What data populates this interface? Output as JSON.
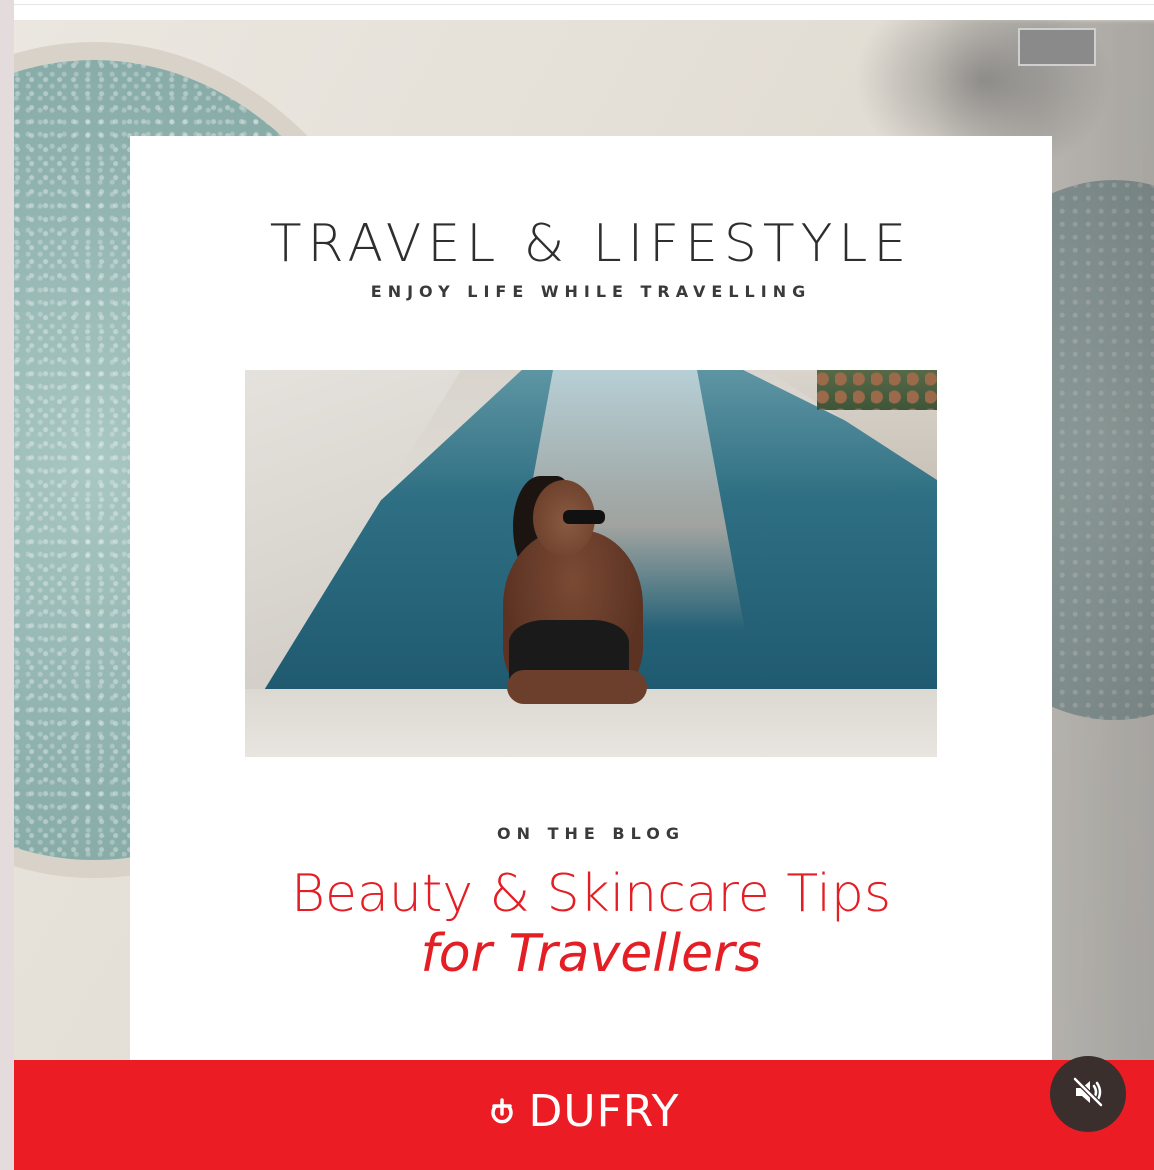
{
  "post": {
    "title": "TRAVEL & LIFESTYLE",
    "subtitle": "ENJOY LIFE WHILE TRAVELLING",
    "kicker": "ON THE BLOG",
    "headline_line1": "Beauty & Skincare Tips",
    "headline_line2": "for Travellers",
    "photo_alt": "Woman in sunglasses leaning on the edge of a pool"
  },
  "brand": {
    "name": "DUFRY",
    "logo_icon": "dufry-logo-icon",
    "bar_color": "#ec1c24"
  },
  "controls": {
    "mute_icon": "muted-speaker-icon",
    "mute_label": "Unmute"
  },
  "colors": {
    "accent": "#e31e24",
    "title_text": "#2e2e2e",
    "card": "#ffffff"
  }
}
